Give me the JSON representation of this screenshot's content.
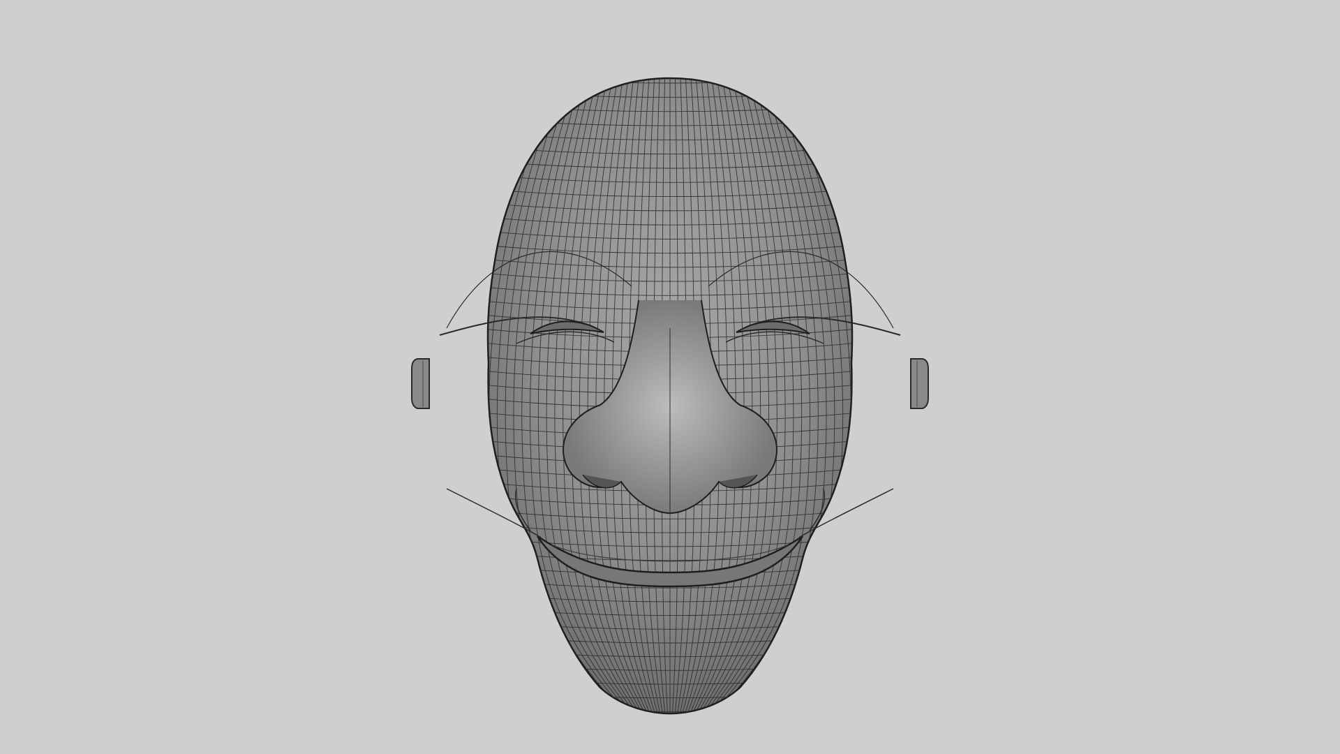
{
  "viewport": {
    "background_color": "#cfcfcf",
    "display_mode": "wireframe-on-shaded",
    "object": {
      "name": "smiling-face-mask",
      "surface_color": "#8f8f8f",
      "wire_color": "#2a2a2a"
    }
  }
}
